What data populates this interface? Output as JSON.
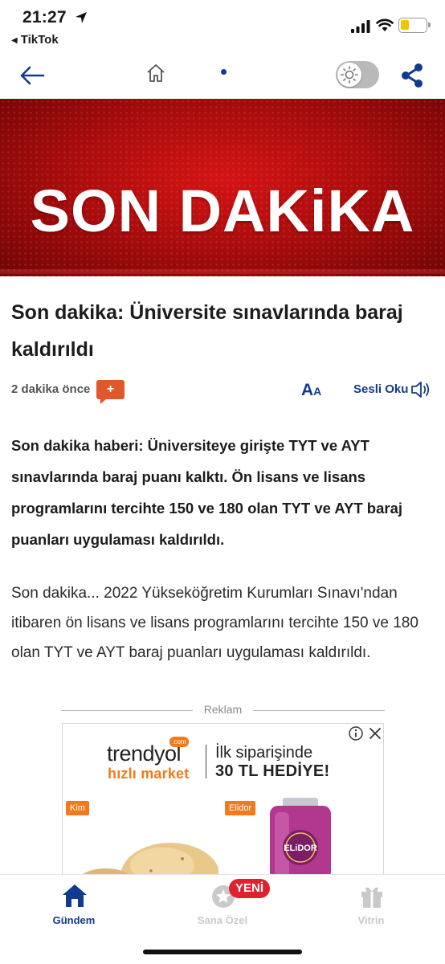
{
  "status_bar": {
    "time": "21:27",
    "back_app": "TikTok",
    "battery_color": "#f5c400"
  },
  "toolbar": {
    "icons": [
      "back-arrow-icon",
      "home-icon",
      "brightness-icon",
      "share-icon"
    ],
    "accent_color": "#123a8e"
  },
  "hero": {
    "title": "SON DAKiKA",
    "background_color": "#c41212"
  },
  "article": {
    "headline": "Son dakika: Üniversite sınavlarında baraj kaldırıldı",
    "time_ago": "2 dakika önce",
    "plus_label": "+",
    "font_size_big": "A",
    "font_size_small": "A",
    "listen_label": "Sesli Oku",
    "lead": "Son dakika haberi: Üniversiteye girişte TYT ve AYT sınavlarında baraj puanı kalktı.  Ön lisans ve lisans programlarını tercihte 150 ve 180 olan TYT ve AYT baraj puanları uygulaması kaldırıldı.",
    "body": "Son dakika... 2022 Yükseköğretim Kurumları Sınavı'ndan itibaren ön lisans ve lisans programlarını tercihte 150 ve 180 olan TYT ve AYT baraj puanları uygulaması kaldırıldı."
  },
  "ad": {
    "label": "Reklam",
    "brand": "trendyol",
    "brand_sup": ".com",
    "brand_sub": "hızlı market",
    "offer_line1": "İlk siparişinde",
    "offer_line2": "30 TL HEDİYE!",
    "tag_left": "Kim",
    "tag_right": "Elidor",
    "accent_color": "#f27a1a"
  },
  "tab_bar": {
    "tabs": [
      {
        "label": "Gündem",
        "icon": "home-icon",
        "active": true
      },
      {
        "label": "Sana Özel",
        "icon": "star-icon",
        "active": false
      },
      {
        "label": "Vitrin",
        "icon": "gift-icon",
        "active": false
      }
    ],
    "badge": "YENİ",
    "active_color": "#123a8e",
    "badge_color": "#e0222e"
  }
}
